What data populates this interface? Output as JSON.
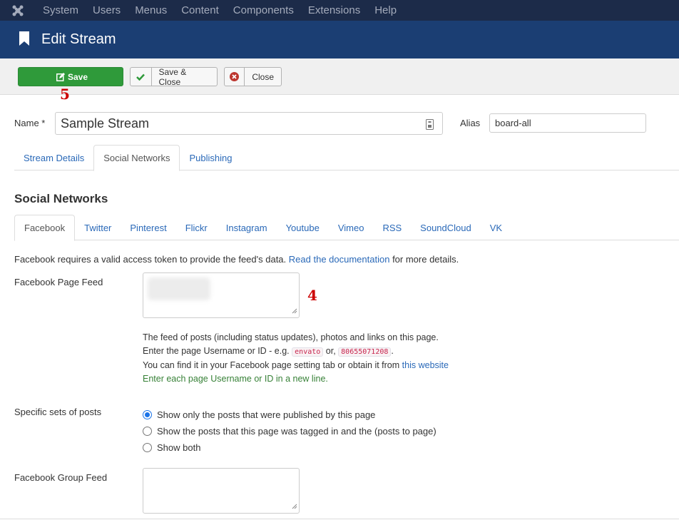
{
  "topnav": {
    "items": [
      "System",
      "Users",
      "Menus",
      "Content",
      "Components",
      "Extensions",
      "Help"
    ]
  },
  "header": {
    "title": "Edit Stream"
  },
  "toolbar": {
    "save_label": "Save",
    "save_close_label": "Save & Close",
    "close_label": "Close"
  },
  "annotations": {
    "save": "5",
    "page_feed": "4"
  },
  "form": {
    "name_label": "Name *",
    "name_value": "Sample Stream",
    "alias_label": "Alias",
    "alias_value": "board-all"
  },
  "tabs": [
    "Stream Details",
    "Social Networks",
    "Publishing"
  ],
  "section_title": "Social Networks",
  "subtabs": [
    "Facebook",
    "Twitter",
    "Pinterest",
    "Flickr",
    "Instagram",
    "Youtube",
    "Vimeo",
    "RSS",
    "SoundCloud",
    "VK"
  ],
  "facebook": {
    "desc_pre": "Facebook requires a valid access token to provide the feed's data.",
    "desc_link": "Read the documentation",
    "desc_post": "for more details.",
    "page_feed_label": "Facebook Page Feed",
    "help_line1": "The feed of posts (including status updates), photos and links on this page.",
    "help_line2_pre": "Enter the page Username or ID - e.g.",
    "help_code1": "envato",
    "help_or": "or,",
    "help_code2": "80655071208",
    "help_line2_post": ".",
    "help_line3_pre": "You can find it in your Facebook page setting tab or obtain it from",
    "help_line3_link": "this website",
    "help_line4": "Enter each page Username or ID in a new line.",
    "specific_label": "Specific sets of posts",
    "radio_options": [
      "Show only the posts that were published by this page",
      "Show the posts that this page was tagged in and the (posts to page)",
      "Show both"
    ],
    "group_feed_label": "Facebook Group Feed"
  },
  "colors": {
    "topnav": "#1c2b49",
    "header": "#1b3e73",
    "save": "#2f9a3a",
    "link": "#2a69b8"
  }
}
